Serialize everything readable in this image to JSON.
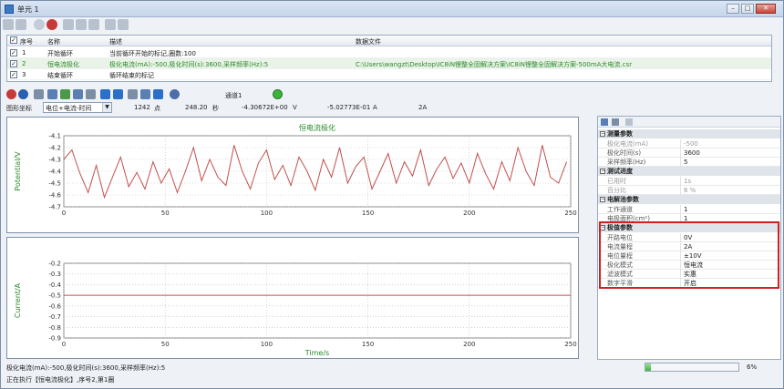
{
  "window": {
    "title": "单元 1",
    "min": "–",
    "max": "□",
    "close": "✕"
  },
  "sequence": {
    "headers": [
      "序号",
      "名称",
      "描述",
      "数据文件"
    ],
    "rows": [
      {
        "no": "1",
        "name": "开始循环",
        "desc": "当前循环开始的标记,圈数:100",
        "file": "",
        "checked": "✓"
      },
      {
        "no": "2",
        "name": "恒电流极化",
        "desc": "极化电流(mA):-500,极化时间(s):3600,采样频率(Hz):5",
        "file": "C:\\Users\\wangzt\\Desktop\\IC8iN锂整全固解决方案\\IC8iN锂整全固解决方案-500mA大电流.csr",
        "checked": "✓"
      },
      {
        "no": "3",
        "name": "结束循环",
        "desc": "循环结束的标记",
        "file": "",
        "checked": "✓"
      }
    ]
  },
  "toolbar2": {
    "channel_label": "通道1",
    "channel_status_color": "#3cb43c"
  },
  "info": {
    "coord_label": "图形坐标",
    "coord_select": "电位+电流-时间",
    "points": "1242",
    "points_unit": "点",
    "time": "248.20",
    "time_unit": "秒",
    "potential": "-4.30672E+00",
    "potential_unit": "V",
    "current": "-5.02773E-01",
    "current_unit": "A",
    "range": "2A"
  },
  "chart_data": [
    {
      "type": "line",
      "title": "恒电流极化",
      "xlabel": "",
      "ylabel": "Potential/V",
      "xlim": [
        0,
        250
      ],
      "ylim": [
        -4.7,
        -4.1
      ],
      "xticks": [
        "0",
        "50",
        "100",
        "150",
        "200",
        "250"
      ],
      "yticks": [
        "-4.1",
        "-4.2",
        "-4.3",
        "-4.4",
        "-4.5",
        "-4.6",
        "-4.7"
      ],
      "color": "#c0504d",
      "x": [
        0,
        4,
        8,
        12,
        16,
        20,
        24,
        28,
        32,
        36,
        40,
        44,
        48,
        52,
        56,
        60,
        64,
        68,
        72,
        76,
        80,
        84,
        88,
        92,
        96,
        100,
        104,
        108,
        112,
        116,
        120,
        124,
        128,
        132,
        136,
        140,
        144,
        148,
        152,
        156,
        160,
        164,
        168,
        172,
        176,
        180,
        184,
        188,
        192,
        196,
        200,
        204,
        208,
        212,
        216,
        220,
        224,
        228,
        232,
        236,
        240,
        244,
        248
      ],
      "y": [
        -4.3,
        -4.22,
        -4.42,
        -4.58,
        -4.35,
        -4.62,
        -4.45,
        -4.28,
        -4.53,
        -4.41,
        -4.55,
        -4.32,
        -4.5,
        -4.38,
        -4.58,
        -4.4,
        -4.2,
        -4.48,
        -4.3,
        -4.45,
        -4.52,
        -4.18,
        -4.4,
        -4.55,
        -4.33,
        -4.22,
        -4.47,
        -4.35,
        -4.52,
        -4.28,
        -4.4,
        -4.56,
        -4.3,
        -4.45,
        -4.2,
        -4.5,
        -4.36,
        -4.28,
        -4.55,
        -4.4,
        -4.25,
        -4.5,
        -4.32,
        -4.44,
        -4.22,
        -4.52,
        -4.38,
        -4.28,
        -4.46,
        -4.33,
        -4.5,
        -4.25,
        -4.42,
        -4.55,
        -4.32,
        -4.48,
        -4.2,
        -4.4,
        -4.52,
        -4.18,
        -4.45,
        -4.5,
        -4.32
      ]
    },
    {
      "type": "line",
      "title": "",
      "xlabel": "Time/s",
      "ylabel": "Current/A",
      "xlim": [
        0,
        250
      ],
      "ylim": [
        -0.9,
        -0.2
      ],
      "xticks": [
        "0",
        "50",
        "100",
        "150",
        "200",
        "250"
      ],
      "yticks": [
        "-0.2",
        "-0.3",
        "-0.4",
        "-0.5",
        "-0.6",
        "-0.7",
        "-0.8",
        "-0.9"
      ],
      "color": "#c0504d",
      "x": [
        0,
        250
      ],
      "y": [
        -0.5,
        -0.5
      ]
    }
  ],
  "properties": {
    "groups": [
      {
        "title": "测量参数",
        "items": [
          {
            "k": "极化电流(mA)",
            "v": "-500",
            "dis": true
          },
          {
            "k": "极化时间(s)",
            "v": "3600",
            "dis": false
          },
          {
            "k": "采样频率(Hz)",
            "v": "5",
            "dis": false
          }
        ]
      },
      {
        "title": "测试进度",
        "items": [
          {
            "k": "已用时",
            "v": "1s",
            "dis": true
          },
          {
            "k": "百分比",
            "v": "6 %",
            "dis": true
          }
        ]
      },
      {
        "title": "电解池参数",
        "items": [
          {
            "k": "工作通道",
            "v": "1",
            "dis": false
          },
          {
            "k": "电极面积(cm²)",
            "v": "1",
            "dis": false
          }
        ]
      },
      {
        "title": "极值参数",
        "items": [
          {
            "k": "开路电位",
            "v": "0V",
            "dis": false
          },
          {
            "k": "电流量程",
            "v": "2A",
            "dis": false
          },
          {
            "k": "电位量程",
            "v": "±10V",
            "dis": false
          },
          {
            "k": "极化模式",
            "v": "恒电流",
            "dis": false
          },
          {
            "k": "滤波模式",
            "v": "实惠",
            "dis": false
          },
          {
            "k": "数字平滑",
            "v": "开启",
            "dis": false
          }
        ]
      }
    ]
  },
  "status": {
    "line1": "极化电流(mA):-500,极化时间(s):3600,采样频率(Hz):5",
    "line2": "正在执行【恒电流极化】,序号2,第1圈",
    "progress": 0.06,
    "progress_text": "6%"
  }
}
